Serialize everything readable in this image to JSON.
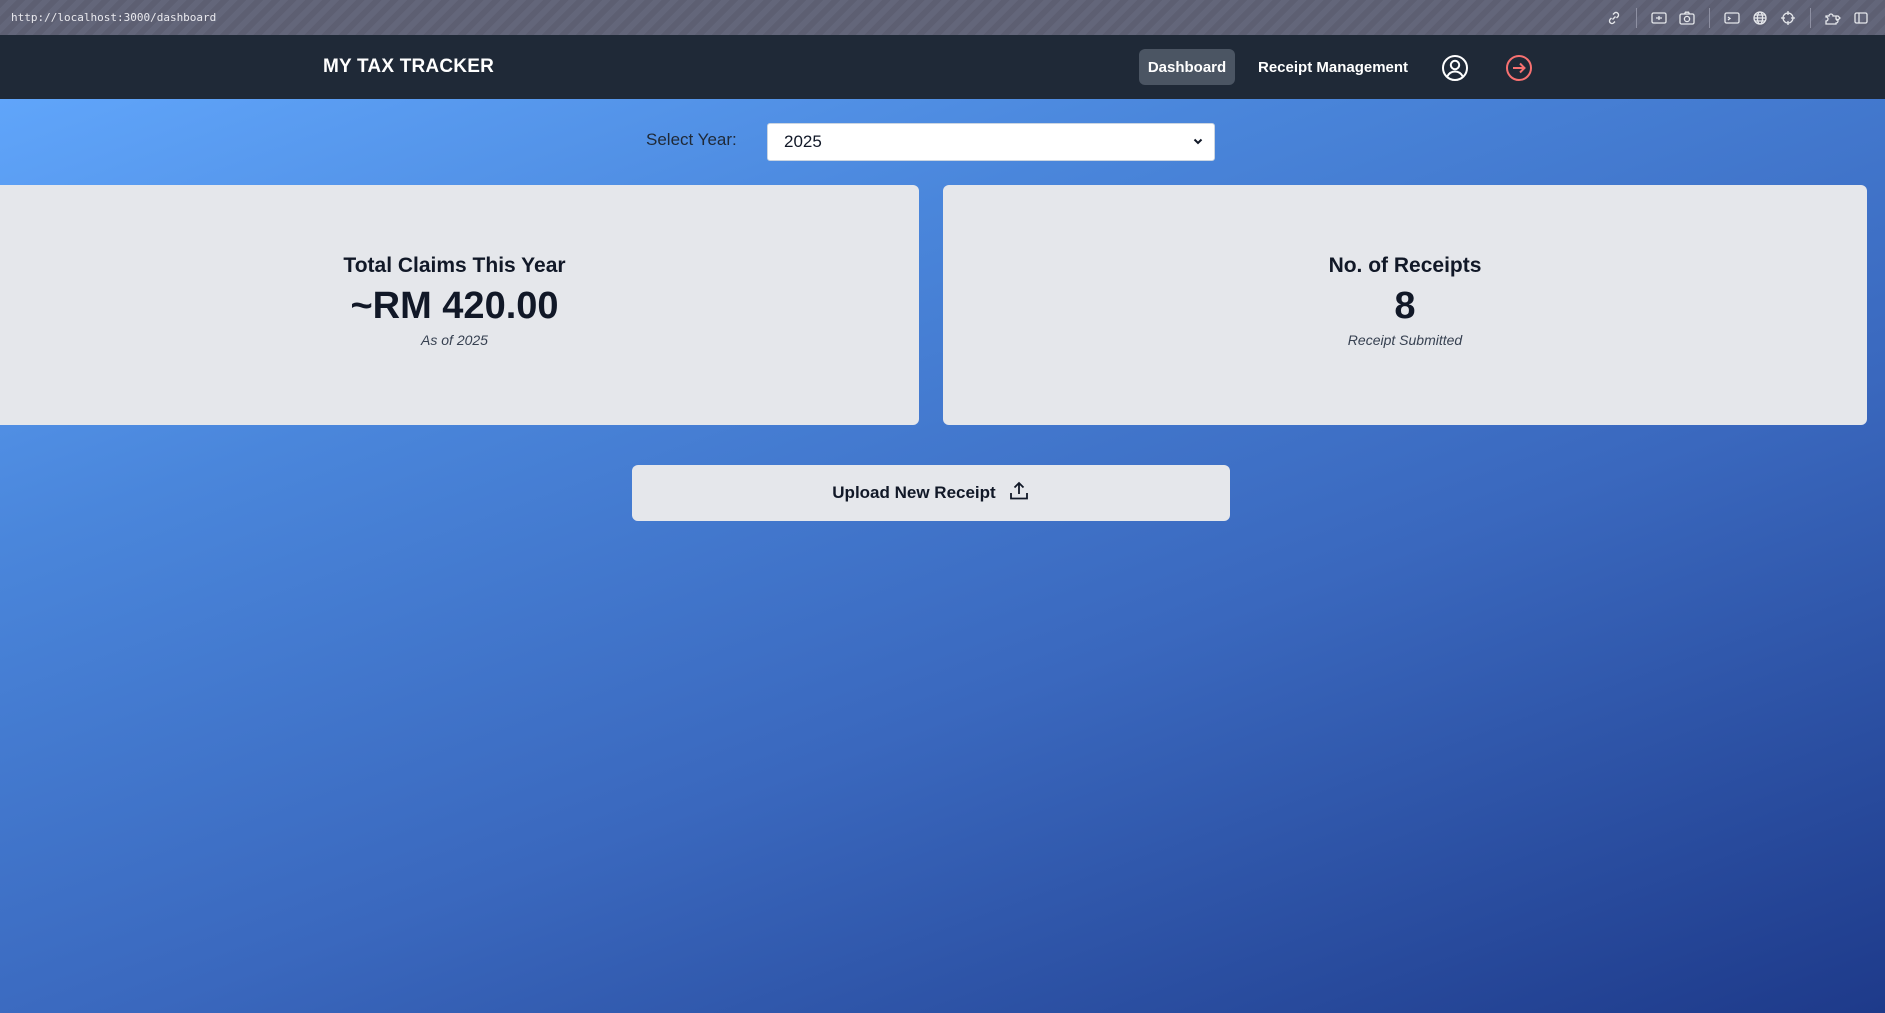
{
  "browser": {
    "url": "http://localhost:3000/dashboard",
    "tools": [
      "link-icon",
      "screenshot-area-icon",
      "camera-icon",
      "terminal-icon",
      "globe-icon",
      "crosshair-icon",
      "extensions-icon",
      "sidebar-icon"
    ]
  },
  "nav": {
    "brand": "MY TAX TRACKER",
    "items": [
      {
        "label": "Dashboard",
        "active": true
      },
      {
        "label": "Receipt Management",
        "active": false
      }
    ],
    "profile_icon": "user-circle-icon",
    "logout_icon": "logout-arrow-icon",
    "logout_color": "#f87171"
  },
  "year_filter": {
    "label": "Select Year:",
    "selected": "2025"
  },
  "stats": {
    "claims": {
      "title": "Total Claims This Year",
      "value": "~RM 420.00",
      "subtitle": "As of 2025"
    },
    "receipts": {
      "title": "No. of Receipts",
      "value": "8",
      "subtitle": "Receipt Submitted"
    }
  },
  "upload": {
    "label": "Upload New Receipt",
    "icon": "upload-icon"
  }
}
